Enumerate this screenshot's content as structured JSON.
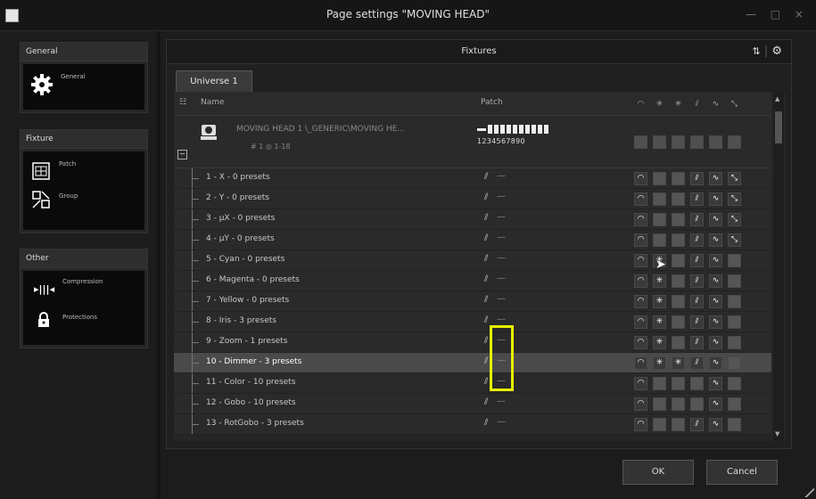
{
  "window": {
    "title": "Page settings \"MOVING HEAD\"",
    "controls": "— □ ×"
  },
  "sidebar": {
    "general": {
      "header": "General",
      "items": [
        {
          "label": "General",
          "icon": "gear-icon"
        }
      ]
    },
    "fixture": {
      "header": "Fixture",
      "items": [
        {
          "label": "Patch",
          "icon": "patch-icon"
        },
        {
          "label": "Group",
          "icon": "group-icon"
        }
      ]
    },
    "other": {
      "header": "Other",
      "items": [
        {
          "label": "Compression",
          "icon": "compression-icon"
        },
        {
          "label": "Protections",
          "icon": "lock-icon"
        }
      ]
    }
  },
  "main": {
    "title": "Fixtures",
    "tab": "Universe 1",
    "columns": {
      "name": "Name",
      "patch": "Patch"
    },
    "fixture": {
      "name": "MOVING HEAD 1 \\_GENERIC\\MOVING HE...",
      "info": "# 1  ◎ 1-18",
      "dip_numbers": "1234567890"
    },
    "channels": [
      {
        "label": "1 - X - 0 presets",
        "cells": [
          "on",
          "off",
          "off",
          "on",
          "on",
          "on"
        ]
      },
      {
        "label": "2 - Y - 0 presets",
        "cells": [
          "on",
          "off",
          "off",
          "on",
          "on",
          "on"
        ]
      },
      {
        "label": "3 - µX - 0 presets",
        "cells": [
          "on",
          "off",
          "off",
          "on",
          "on",
          "on"
        ]
      },
      {
        "label": "4 - µY - 0 presets",
        "cells": [
          "on",
          "off",
          "off",
          "on",
          "on",
          "on"
        ]
      },
      {
        "label": "5 - Cyan - 0 presets",
        "cells": [
          "on",
          "on",
          "off",
          "on",
          "on",
          "off"
        ]
      },
      {
        "label": "6 - Magenta - 0 presets",
        "cells": [
          "on",
          "on",
          "off",
          "on",
          "on",
          "off"
        ]
      },
      {
        "label": "7 - Yellow - 0 presets",
        "cells": [
          "on",
          "on",
          "off",
          "on",
          "on",
          "off"
        ]
      },
      {
        "label": "8 - Iris - 3 presets",
        "cells": [
          "on",
          "on",
          "off",
          "on",
          "on",
          "off"
        ]
      },
      {
        "label": "9 - Zoom - 1 presets",
        "cells": [
          "on",
          "on",
          "off",
          "on",
          "on",
          "off"
        ]
      },
      {
        "label": "10 - Dimmer - 3 presets",
        "cells": [
          "on",
          "on",
          "on",
          "on",
          "on",
          "off"
        ],
        "selected": true
      },
      {
        "label": "11 - Color - 10 presets",
        "cells": [
          "on",
          "off",
          "off",
          "off",
          "on",
          "off"
        ]
      },
      {
        "label": "12 - Gobo - 10 presets",
        "cells": [
          "on",
          "off",
          "off",
          "off",
          "on",
          "off"
        ]
      },
      {
        "label": "13 - RotGobo - 3 presets",
        "cells": [
          "on",
          "off",
          "off",
          "on",
          "on",
          "off"
        ]
      }
    ]
  },
  "buttons": {
    "ok": "OK",
    "cancel": "Cancel"
  }
}
